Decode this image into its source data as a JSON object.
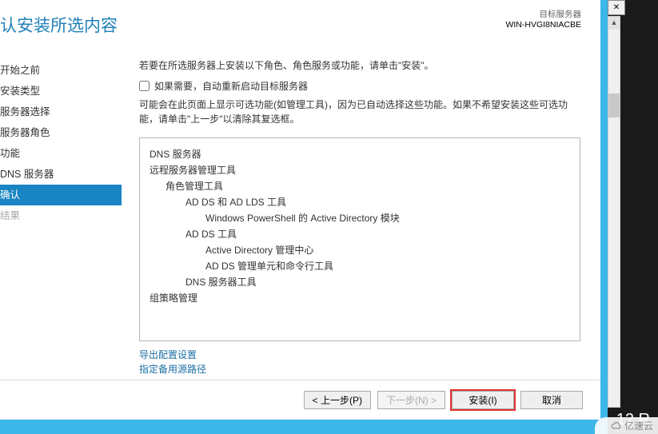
{
  "header": {
    "title": "认安装所选内容",
    "target_label": "目标服务器",
    "target_server": "WIN-HVGI8NIACBE"
  },
  "sidebar": {
    "items": [
      {
        "label": "开始之前"
      },
      {
        "label": "安装类型"
      },
      {
        "label": "服务器选择"
      },
      {
        "label": "服务器角色"
      },
      {
        "label": "功能"
      },
      {
        "label": "DNS 服务器"
      },
      {
        "label": "确认",
        "active": true
      },
      {
        "label": "结果",
        "disabled": true
      }
    ]
  },
  "main": {
    "intro": "若要在所选服务器上安装以下角色、角色服务或功能，请单击\"安装\"。",
    "restart_checkbox_label": "如果需要，自动重新启动目标服务器",
    "note": "可能会在此页面上显示可选功能(如管理工具)，因为已自动选择这些功能。如果不希望安装这些可选功能，请单击\"上一步\"以清除其复选框。",
    "tree": [
      {
        "level": 1,
        "text": "DNS 服务器"
      },
      {
        "level": 1,
        "text": "远程服务器管理工具"
      },
      {
        "level": 2,
        "text": "角色管理工具"
      },
      {
        "level": 3,
        "text": "AD DS 和 AD LDS 工具"
      },
      {
        "level": 4,
        "text": "Windows PowerShell 的 Active Directory 模块"
      },
      {
        "level": 3,
        "text": "AD DS 工具"
      },
      {
        "level": 4,
        "text": "Active Directory 管理中心"
      },
      {
        "level": 4,
        "text": "AD DS 管理单元和命令行工具"
      },
      {
        "level": 3,
        "text": "DNS 服务器工具"
      },
      {
        "level": 1,
        "text": "组策略管理"
      }
    ],
    "links": {
      "export": "导出配置设置",
      "alternate_source": "指定备用源路径"
    }
  },
  "footer": {
    "previous": "< 上一步(P)",
    "next": "下一步(N) >",
    "install": "安装(I)",
    "cancel": "取消"
  },
  "titlebar": {
    "close_glyph": "✕"
  },
  "brand": {
    "os_suffix": "12 R",
    "watermark": "亿速云"
  }
}
